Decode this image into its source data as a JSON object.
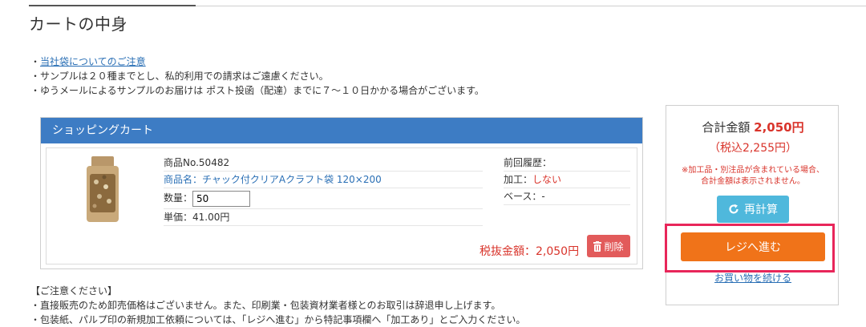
{
  "page": {
    "title": "カートの中身"
  },
  "notes": {
    "bullet": "・",
    "link_text": "当社袋についてのご注意",
    "line2": "・サンプルは２０種までとし、私的利用での請求はご遠慮ください。",
    "line3": "・ゆうメールによるサンプルのお届けは ポスト投函（配達）までに７～１０日かかる場合がございます。"
  },
  "cart": {
    "header": "ショッピングカート",
    "item": {
      "product_no": "商品No.50482",
      "product_name": "商品名：チャック付クリアAクラフト袋 120×200",
      "qty_label": "数量：",
      "qty_value": "50",
      "unit_price": "単価：41.00円",
      "history": "前回履歴：",
      "processing_label": "加工：",
      "processing_value": "しない",
      "base": "ベース：-",
      "subtotal": "税抜金額：2,050円",
      "delete_label": "削除"
    }
  },
  "summary": {
    "total_label": "合計金額 ",
    "total_value": "2,050円",
    "tax_included": "（税込2,255円）",
    "note": "※加工品・別注品が含まれている場合、合計金額は表示されません。",
    "recalc_label": "再計算",
    "checkout_label": "レジへ進む",
    "continue_label": "お買い物を続ける"
  },
  "bottom_notes": {
    "heading": "【ご注意ください】",
    "line1": "・直接販売のため卸売価格はございません。また、印刷業・包装資材業者様とのお取引は辞退申し上げます。",
    "line2": "・包装紙、パルプ印の新規加工依頼については、「レジへ進む」から特記事項欄へ「加工あり」とご入力ください。"
  },
  "colors": {
    "header_blue": "#3d7cc4",
    "price_red": "#d9342b",
    "checkout_orange": "#f07319",
    "recalc_cyan": "#4fb8dc",
    "delete_red": "#e25b5b",
    "highlight_pink": "#e8265a"
  },
  "icons": {
    "recalc": "refresh-icon",
    "delete": "trash-icon",
    "product": "product-thumbnail"
  }
}
